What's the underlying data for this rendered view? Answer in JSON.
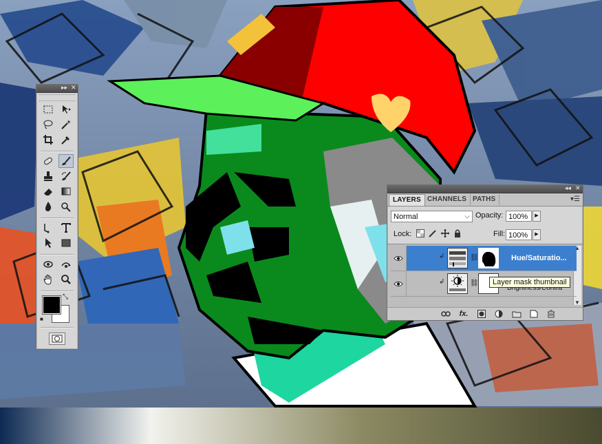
{
  "tools_panel": {
    "tools": [
      "rectangular-marquee",
      "move",
      "lasso",
      "magic-wand",
      "crop",
      "eyedropper",
      "spot-healing-brush",
      "brush",
      "clone-stamp",
      "history-brush",
      "eraser",
      "gradient",
      "blur",
      "dodge",
      "pen",
      "type",
      "path-selection",
      "rectangle",
      "3d-rotate",
      "3d-orbit",
      "hand",
      "zoom"
    ],
    "active_tool": "brush",
    "foreground_color": "#000000",
    "background_color": "#ffffff"
  },
  "layers_panel": {
    "tabs": [
      "LAYERS",
      "CHANNELS",
      "PATHS"
    ],
    "active_tab": "LAYERS",
    "blend_mode": "Normal",
    "opacity_label": "Opacity:",
    "opacity_value": "100%",
    "lock_label": "Lock:",
    "fill_label": "Fill:",
    "fill_value": "100%",
    "layers": [
      {
        "name": "Hue/Saturatio...",
        "selected": true
      },
      {
        "name": "Brightness/Contra",
        "selected": false
      }
    ],
    "footer_icons": [
      "link-layers-icon",
      "fx-icon",
      "add-mask-icon",
      "adjustment-layer-icon",
      "new-group-icon",
      "new-layer-icon",
      "trash-icon"
    ]
  },
  "tooltip": {
    "text": "Layer mask thumbnail"
  },
  "colors": {
    "selection": "#3c7fcf",
    "panel_bg": "#d6d6d6",
    "cap_red": "#ff0000",
    "face_green": "#0a8a1c"
  }
}
